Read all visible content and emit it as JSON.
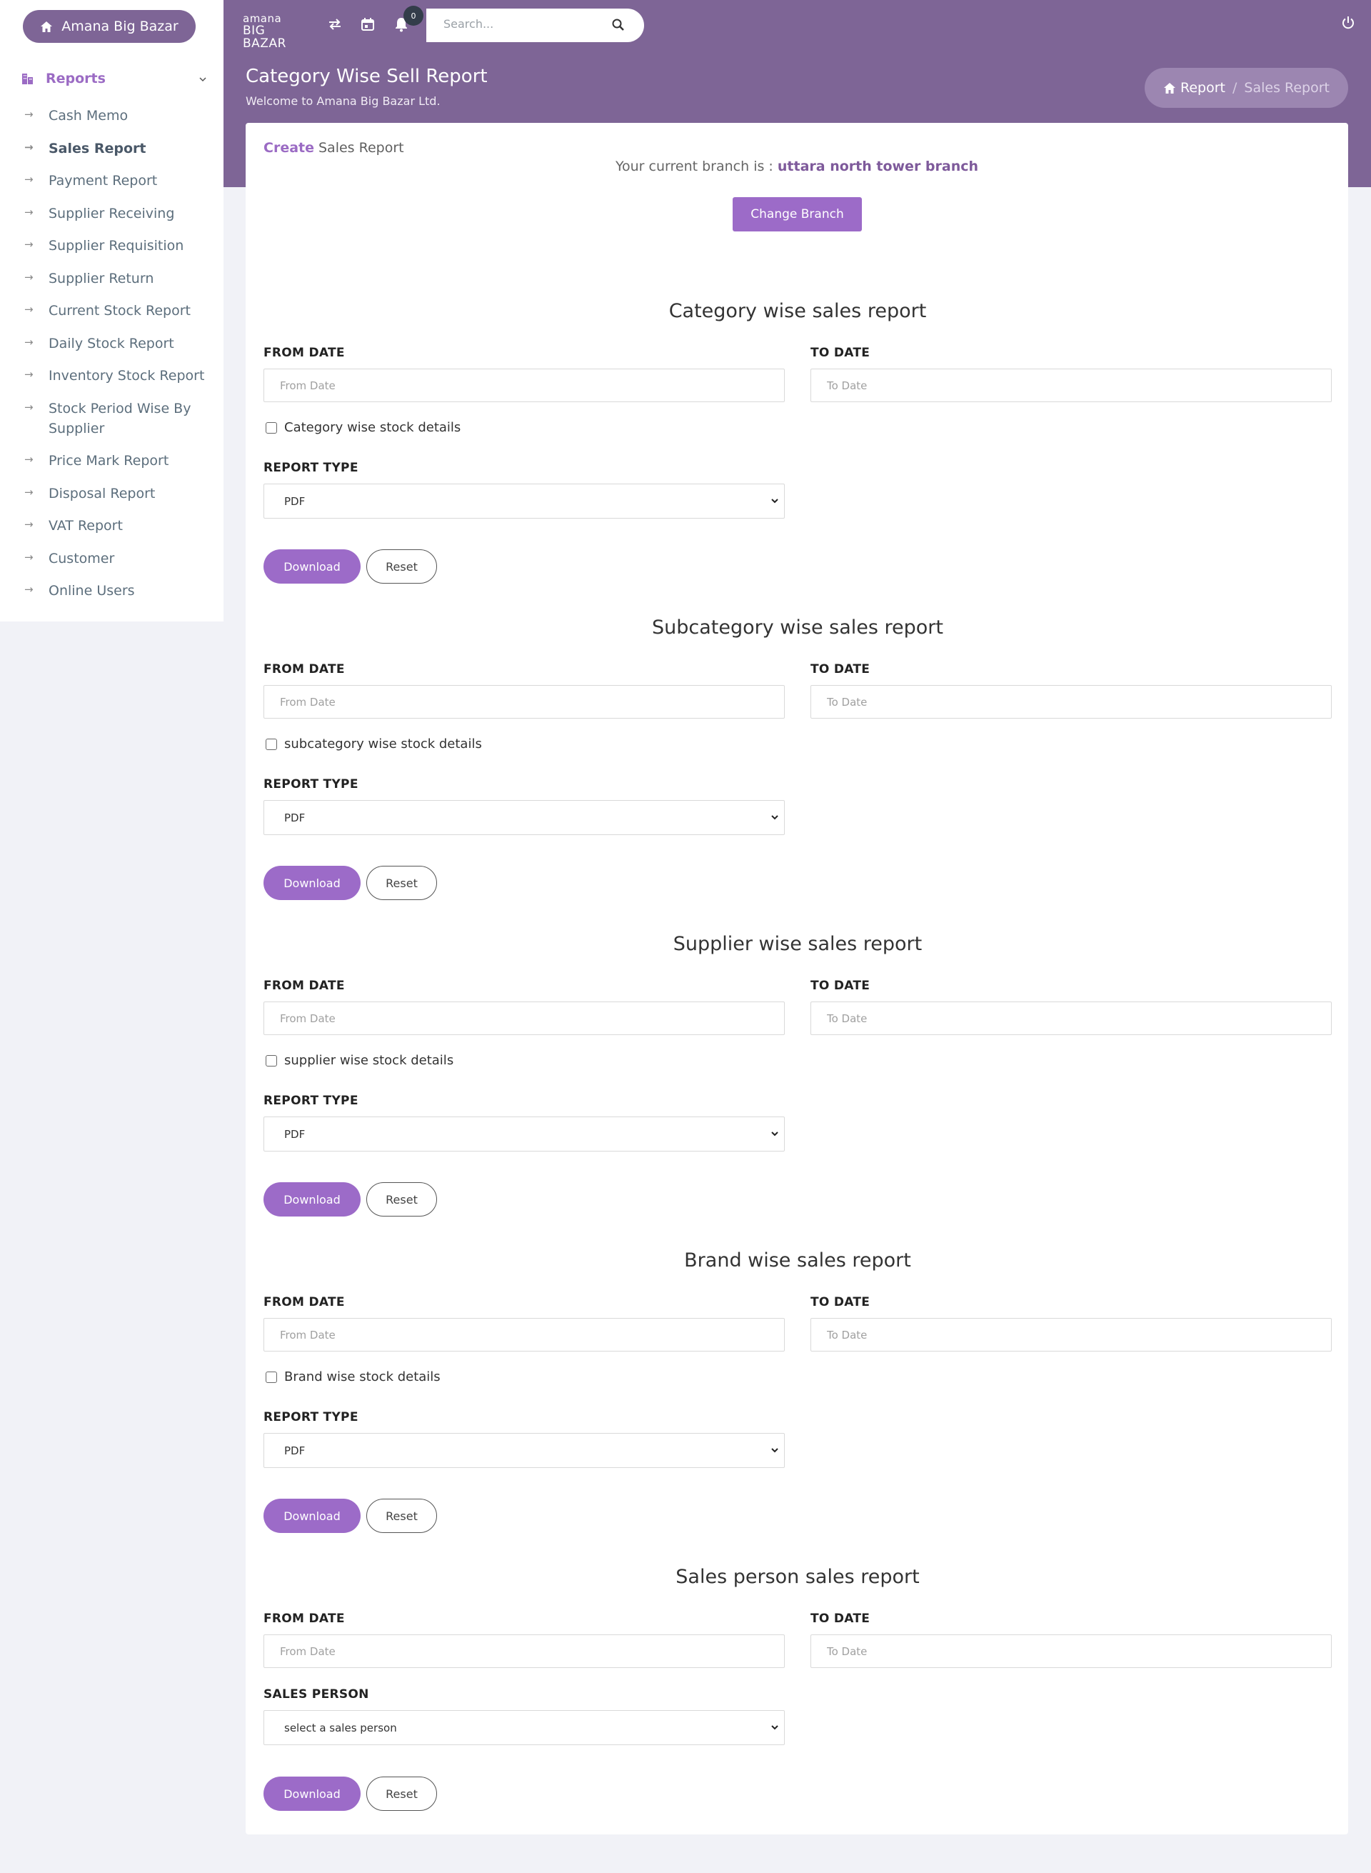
{
  "sidebar": {
    "brand": "Amana Big Bazar",
    "section": "Reports",
    "items": [
      {
        "label": "Cash Memo"
      },
      {
        "label": "Sales Report"
      },
      {
        "label": "Payment Report"
      },
      {
        "label": "Supplier Receiving"
      },
      {
        "label": "Supplier Requisition"
      },
      {
        "label": "Supplier Return"
      },
      {
        "label": "Current Stock Report"
      },
      {
        "label": "Daily Stock Report"
      },
      {
        "label": "Inventory Stock Report"
      },
      {
        "label": "Stock Period Wise By Supplier"
      },
      {
        "label": "Price Mark Report"
      },
      {
        "label": "Disposal Report"
      },
      {
        "label": "VAT Report"
      },
      {
        "label": "Customer"
      },
      {
        "label": "Online Users"
      }
    ]
  },
  "header": {
    "logo_line1": "amana",
    "logo_line2": "BIG BAZAR",
    "notification_count": "0",
    "search_placeholder": "Search...",
    "title": "Category Wise Sell Report",
    "subtitle": "Welcome to Amana Big Bazar Ltd.",
    "breadcrumb": {
      "home": "Report",
      "separator": "/",
      "current": "Sales Report"
    }
  },
  "card": {
    "create_word": "Create",
    "heading": "Sales Report",
    "branch_prefix": "Your current branch is :",
    "branch_name": "uttara north tower branch",
    "change_branch": "Change Branch"
  },
  "sections": [
    {
      "title": "Category wise sales report",
      "from_label": "FROM DATE",
      "from_placeholder": "From Date",
      "to_label": "TO DATE",
      "to_placeholder": "To Date",
      "checkbox_label": "Category wise stock details",
      "select_label": "REPORT TYPE",
      "select_value": "PDF",
      "download": "Download",
      "reset": "Reset"
    },
    {
      "title": "Subcategory wise sales report",
      "from_label": "FROM DATE",
      "from_placeholder": "From Date",
      "to_label": "TO DATE",
      "to_placeholder": "To Date",
      "checkbox_label": "subcategory wise stock details",
      "select_label": "REPORT TYPE",
      "select_value": "PDF",
      "download": "Download",
      "reset": "Reset"
    },
    {
      "title": "Supplier wise sales report",
      "from_label": "FROM DATE",
      "from_placeholder": "From Date",
      "to_label": "TO DATE",
      "to_placeholder": "To Date",
      "checkbox_label": "supplier wise stock details",
      "select_label": "REPORT TYPE",
      "select_value": "PDF",
      "download": "Download",
      "reset": "Reset"
    },
    {
      "title": "Brand wise sales report",
      "from_label": "FROM DATE",
      "from_placeholder": "From Date",
      "to_label": "TO DATE",
      "to_placeholder": "To Date",
      "checkbox_label": "Brand wise stock details",
      "select_label": "REPORT TYPE",
      "select_value": "PDF",
      "download": "Download",
      "reset": "Reset"
    },
    {
      "title": "Sales person sales report",
      "from_label": "FROM DATE",
      "from_placeholder": "From Date",
      "to_label": "TO DATE",
      "to_placeholder": "To Date",
      "select_label": "SALES PERSON",
      "select_value": "select a sales person",
      "download": "Download",
      "reset": "Reset"
    }
  ],
  "colors": {
    "header": "#7e6596",
    "accent": "#9c6bc8",
    "background": "#f1f2f7"
  }
}
